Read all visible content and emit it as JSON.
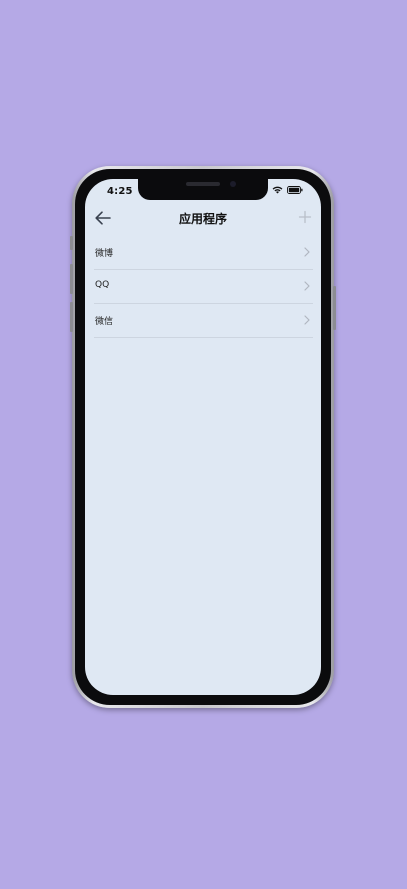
{
  "status_bar": {
    "time": "4:25",
    "wifi_icon": "wifi-icon",
    "battery_icon": "battery-icon"
  },
  "nav": {
    "title": "应用程序",
    "back_icon": "arrow-left-icon",
    "add_icon": "plus-icon"
  },
  "list": {
    "items": [
      {
        "label": "微博",
        "icon": "chevron-right-icon"
      },
      {
        "label": "QQ",
        "icon": "chevron-right-icon"
      },
      {
        "label": "微信",
        "icon": "chevron-right-icon"
      }
    ]
  },
  "colors": {
    "background": "#b5a9e6",
    "screen": "#dfe8f3",
    "divider": "#cdd5e0"
  }
}
